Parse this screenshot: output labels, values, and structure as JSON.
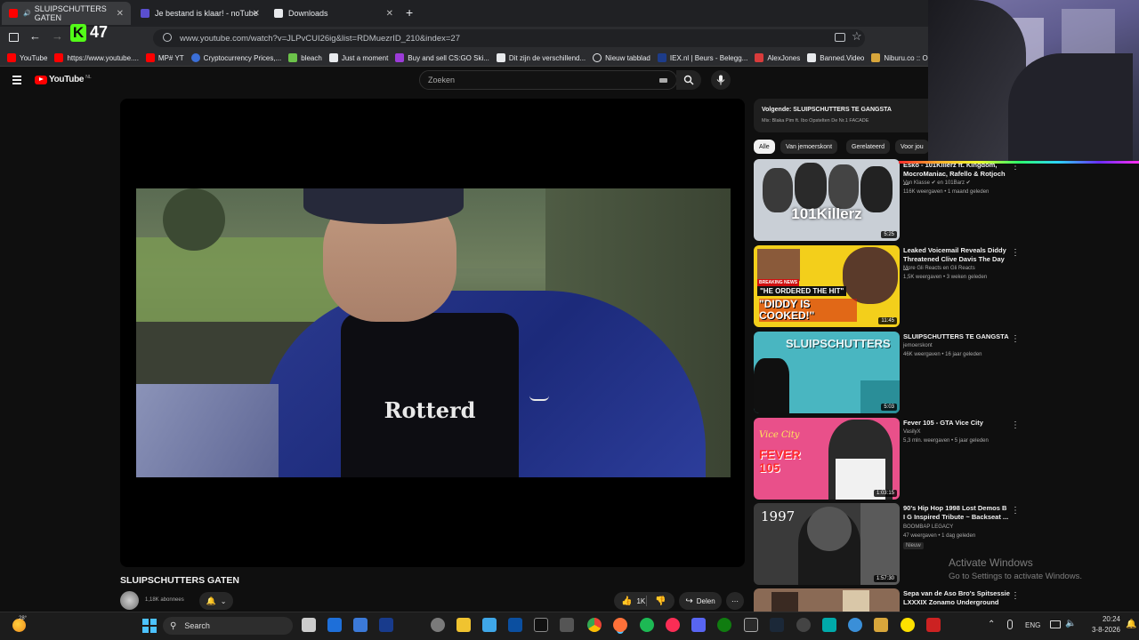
{
  "browser": {
    "tabs": [
      {
        "label": "SLUIPSCHUTTERS GATEN",
        "active": true,
        "color": "#ff0000"
      },
      {
        "label": "Je bestand is klaar! - noTube",
        "active": false,
        "color": "#5a4fcf"
      },
      {
        "label": "Downloads",
        "active": false,
        "color": "#e8eaed"
      }
    ],
    "counter_value": "47",
    "url": "www.youtube.com/watch?v=JLPvCUI26ig&list=RDMuezrID_210&index=27",
    "bookmarks": [
      {
        "label": "YouTube",
        "color": "#ff0000"
      },
      {
        "label": "https://www.youtube....",
        "color": "#ff0000"
      },
      {
        "label": "MP# YT",
        "color": "#ff0000"
      },
      {
        "label": "Cryptocurrency Prices,...",
        "color": "#3b6fd8"
      },
      {
        "label": "bleach",
        "color": "#6cc24a"
      },
      {
        "label": "Just a moment",
        "color": "#e8eaed"
      },
      {
        "label": "Buy and sell CS:GO Ski...",
        "color": "#9c3bd8"
      },
      {
        "label": "Dit zijn de verschillend...",
        "color": "#e8eaed"
      },
      {
        "label": "Nieuw tabblad",
        "color": "#e8eaed"
      },
      {
        "label": "IEX.nl | Beurs - Belegg...",
        "color": "#1d3c8a"
      },
      {
        "label": "AlexJones",
        "color": "#d83b3b"
      },
      {
        "label": "Banned.Video",
        "color": "#e8eaed"
      },
      {
        "label": "Niburu.co :: Onthulle",
        "color": "#d8a63b"
      }
    ]
  },
  "youtube": {
    "logo_text": "YouTube",
    "logo_region": "NL",
    "search_placeholder": "Zoeken",
    "video_title": "SLUIPSCHUTTERS GATEN",
    "subscribers": "1,18K abonnees",
    "likes": "1K",
    "share_label": "Delen",
    "shirt_text": "Rotterd",
    "up_next": {
      "label": "Volgende: SLUIPSCHUTTERS TE GANGSTA",
      "mix": "Mix: Blaka Pim ft. Ibo Opstelten De Nr.1 FACADE"
    },
    "chips": [
      "Alle",
      "Van jemoerskont",
      "Gerelateerd",
      "Voor jou"
    ],
    "recommendations": [
      {
        "title": "Esko - 101Killerz ft. Kingdom, MocroManiac, Rafello & Rotjoch ...",
        "channel": "Van Klasse ✔ en 101Barz ✔",
        "meta": "116K weergaven • 1 maand geleden",
        "duration": "5:25",
        "thumb_text": "101Killerz",
        "thumb_color": "#c9cfd6",
        "thumb_text_color": "#1a1a1a"
      },
      {
        "title": "Leaked Voicemail Reveals Diddy Threatened Clive Davis The Day ...",
        "channel": "More Gli Reacts en Gli Reacts",
        "meta": "1,5K weergaven • 3 weken geleden",
        "duration": "11:45",
        "thumb_text": "\"DIDDY IS COOKED!\"",
        "thumb_sub": "\"HE ORDERED THE HIT\"",
        "thumb_badge": "BREAKING NEWS",
        "thumb_color": "#f3cf1b",
        "thumb_text_color": "#ffffff"
      },
      {
        "title": "SLUIPSCHUTTERS TE GANGSTA",
        "channel": "jemoerskont",
        "meta": "46K weergaven • 16 jaar geleden",
        "duration": "5:03",
        "thumb_text": "SLUIPSCHUTTERS",
        "thumb_color": "#49b6c1",
        "thumb_text_color": "#e9f7f8"
      },
      {
        "title": "Fever 105 - GTA Vice City",
        "channel": "VasilyX",
        "meta": "5,3 mln. weergaven • 5 jaar geleden",
        "duration": "1:03:15",
        "thumb_text": "FEVER 105",
        "thumb_sub": "Vice City",
        "thumb_color": "#e9508a",
        "thumb_text_color": "#ffffff"
      },
      {
        "title": "90's Hip Hop 1998 Lost Demos B I G Inspired Tribute ~ Backseat ...",
        "channel": "BOOMBAP LEGACY",
        "meta": "47 weergaven • 1 dag geleden",
        "badge": "Nieuw",
        "duration": "1:57:30",
        "thumb_text": "1997",
        "thumb_color": "#3a3a3a",
        "thumb_text_color": "#ffffff"
      },
      {
        "title": "Sepa van de Aso Bro's Spitsessie LXXXIX Zonamo Underground",
        "channel": "",
        "meta": "",
        "duration": "",
        "thumb_text": "",
        "thumb_color": "#8a6a55",
        "thumb_text_color": "#ffffff"
      }
    ]
  },
  "overlay": {
    "activate_title": "Activate Windows",
    "activate_sub": "Go to Settings to activate Windows."
  },
  "taskbar": {
    "weather_temp": "28°",
    "search_label": "Search",
    "language": "ENG",
    "time": "20:24",
    "date": "3-8-2026"
  }
}
